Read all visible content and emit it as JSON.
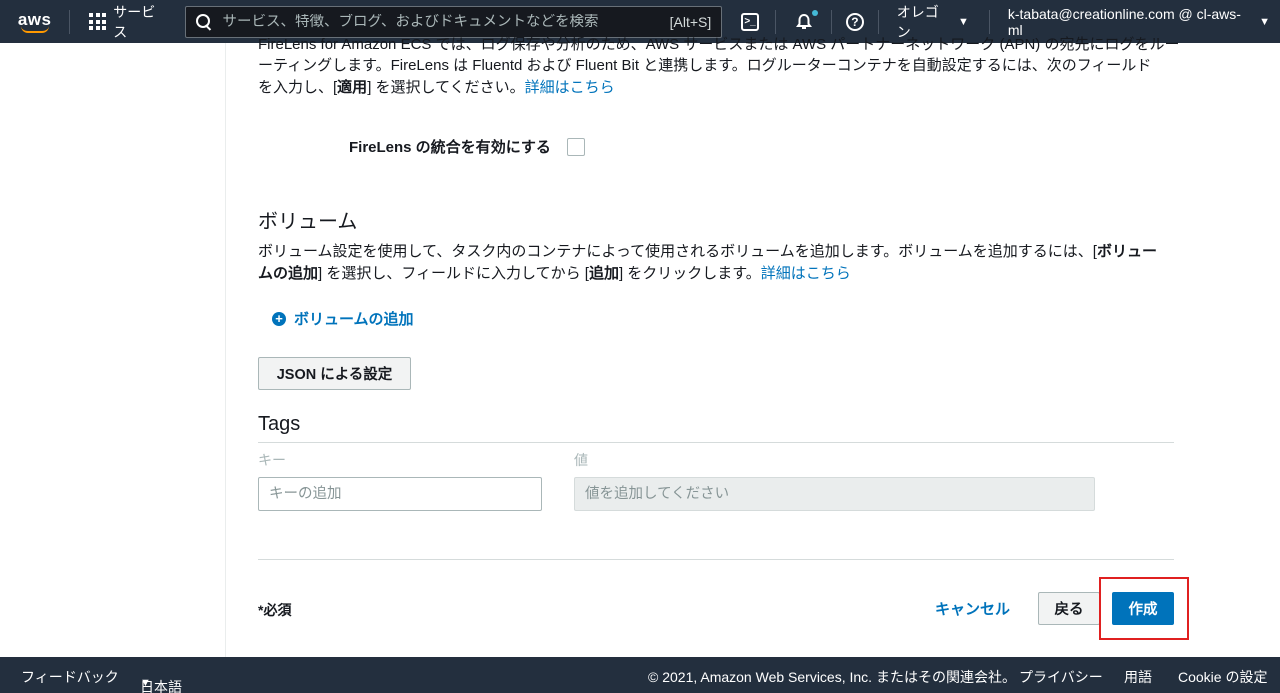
{
  "topnav": {
    "logo_text": "aws",
    "services_label": "サービス",
    "search_placeholder": "サービス、特徴、ブログ、およびドキュメントなどを検索",
    "search_shortcut": "[Alt+S]",
    "cloudshell_glyph": ">_",
    "region_label": "オレゴン",
    "account_label": "k-tabata@creationline.com @ cl-aws-ml",
    "colors": {
      "bg": "#232f3e",
      "notification_dot": "#44b9d6",
      "logo_smile": "#ff9900"
    }
  },
  "firelens": {
    "description_partial": "FireLens for Amazon ECS では、ログ保存や分析のため、AWS サービスまたは AWS パートナーネットワーク (APN) の宛先にログをルー",
    "description_line2": "ーティングします。FireLens は Fluentd および Fluent Bit と連携します。ログルーターコンテナを自動設定するには、次のフィールド",
    "description_line3_pre": "を入力し、[",
    "description_line3_bold": "適用",
    "description_line3_post": "] を選択してください。",
    "learn_more": "詳細はこちら",
    "enable_label": "FireLens の統合を有効にする",
    "enable_checked": false
  },
  "volumes": {
    "title": "ボリューム",
    "desc_1": "ボリューム設定を使用して、タスク内のコンテナによって使用されるボリュームを追加します。ボリュームを追加するには、[",
    "desc_bold_1": "ボリュー",
    "desc_bold_2": "ムの追加",
    "desc_2": "] を選択し、フィールドに入力してから [",
    "desc_bold_3": "追加",
    "desc_3": "] をクリックします。",
    "learn_more": "詳細はこちら",
    "add_label": "ボリュームの追加"
  },
  "json_button": "JSON による設定",
  "tags": {
    "title": "Tags",
    "key_header": "キー",
    "value_header": "値",
    "key_placeholder": "キーの追加",
    "value_placeholder": "値を追加してください"
  },
  "footer_actions": {
    "required": "*必須",
    "cancel": "キャンセル",
    "back": "戻る",
    "create": "作成",
    "colors": {
      "primary": "#0073bb",
      "highlight": "#e02020"
    }
  },
  "footer": {
    "feedback": "フィードバック",
    "language": "日本語",
    "copyright": "© 2021, Amazon Web Services, Inc. またはその関連会社。",
    "privacy": "プライバシー",
    "terms": "用語",
    "cookie": "Cookie の設定"
  }
}
